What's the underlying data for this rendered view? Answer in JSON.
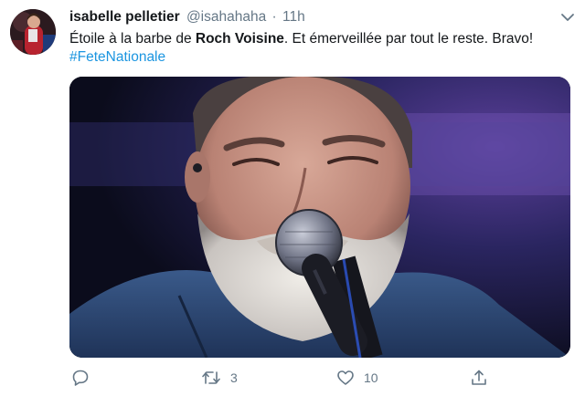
{
  "tweet": {
    "display_name": "isabelle pelletier",
    "handle": "@isahahaha",
    "separator": "·",
    "time": "11h",
    "text_prefix": "Étoile à la barbe de ",
    "text_bold": "Roch Voisine",
    "text_suffix": ".  Et émerveillée par tout le reste.  Bravo!",
    "hashtag": "#FeteNationale"
  },
  "actions": {
    "reply_count": "",
    "retweet_count": "3",
    "like_count": "10"
  },
  "icons": {
    "caret": "chevron-down-icon",
    "reply": "reply-icon",
    "retweet": "retweet-icon",
    "like": "heart-icon",
    "share": "share-icon"
  },
  "colors": {
    "text": "#14171a",
    "secondary": "#657786",
    "link": "#1b95e0"
  }
}
